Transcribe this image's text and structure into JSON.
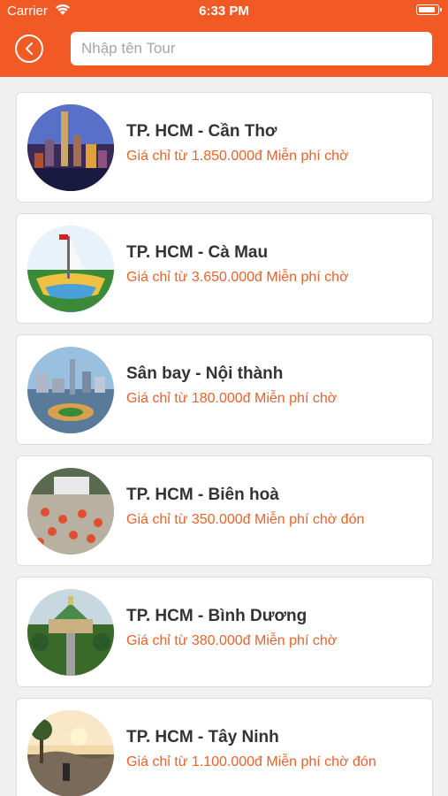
{
  "status_bar": {
    "carrier": "Carrier",
    "time": "6:33 PM",
    "wifi_icon": "wifi-icon",
    "battery_icon": "battery-icon"
  },
  "header": {
    "back_icon": "chevron-left-icon",
    "search": {
      "placeholder": "Nhập tên Tour",
      "value": ""
    },
    "color": "#f15a24"
  },
  "tours": [
    {
      "title": "TP. HCM - Cần Thơ",
      "price": "Giá chỉ từ 1.850.000đ Miễn phí chờ"
    },
    {
      "title": "TP. HCM - Cà Mau",
      "price": "Giá chỉ từ 3.650.000đ Miễn phí chờ"
    },
    {
      "title": "Sân bay - Nội thành",
      "price": "Giá chỉ từ 180.000đ Miễn phí chờ"
    },
    {
      "title": "TP. HCM - Biên hoà",
      "price": "Giá chỉ từ 350.000đ Miễn phí chờ đón"
    },
    {
      "title": "TP. HCM - Bình Dương",
      "price": "Giá chỉ từ 380.000đ Miễn phí chờ"
    },
    {
      "title": "TP. HCM - Tây Ninh",
      "price": "Giá chỉ từ 1.100.000đ Miễn phí chờ đón"
    }
  ],
  "colors": {
    "accent": "#f15a24",
    "price": "#e8632b",
    "title": "#333333",
    "background": "#f0f0f0"
  }
}
